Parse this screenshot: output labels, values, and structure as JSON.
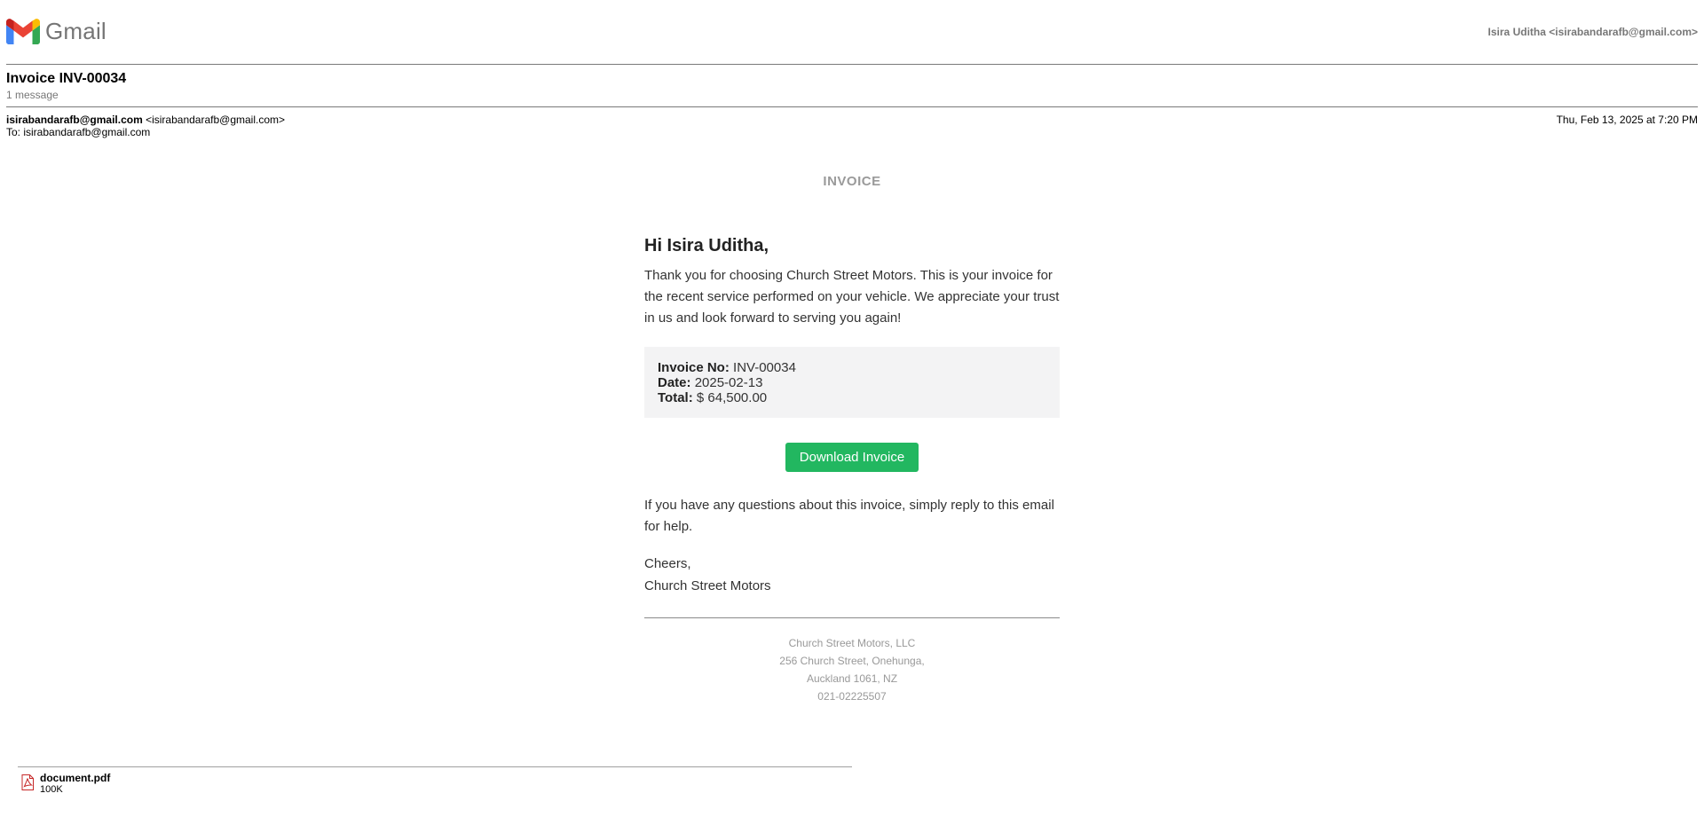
{
  "header": {
    "app_name": "Gmail",
    "account": "Isira Uditha <isirabandarafb@gmail.com>"
  },
  "thread": {
    "subject": "Invoice INV-00034",
    "message_count": "1 message"
  },
  "message": {
    "from_address": "isirabandarafb@gmail.com",
    "from_full": "<isirabandarafb@gmail.com>",
    "to": "To: isirabandarafb@gmail.com",
    "date": "Thu, Feb 13, 2025 at 7:20 PM"
  },
  "body": {
    "heading": "INVOICE",
    "greeting": "Hi Isira Uditha,",
    "intro": "Thank you for choosing Church Street Motors. This is your invoice for the recent service performed on your vehicle. We appreciate your trust in us and look forward to serving you again!",
    "invoice_no_label": "Invoice No:",
    "invoice_no": "INV-00034",
    "date_label": "Date:",
    "date": "2025-02-13",
    "total_label": "Total:",
    "total": "$ 64,500.00",
    "button_label": "Download Invoice",
    "question": "If you have any questions about this invoice, simply reply to this email for help.",
    "closing": "Cheers,",
    "signature": "Church Street Motors",
    "footer": {
      "company": "Church Street Motors, LLC",
      "address1": "256 Church Street, Onehunga,",
      "address2": "Auckland 1061, NZ",
      "phone": "021-02225507"
    }
  },
  "attachment": {
    "name": "document.pdf",
    "size": "100K",
    "icon": "pdf-icon"
  },
  "colors": {
    "button": "#22b760",
    "details_bg": "#f3f3f4",
    "muted": "#999999"
  }
}
